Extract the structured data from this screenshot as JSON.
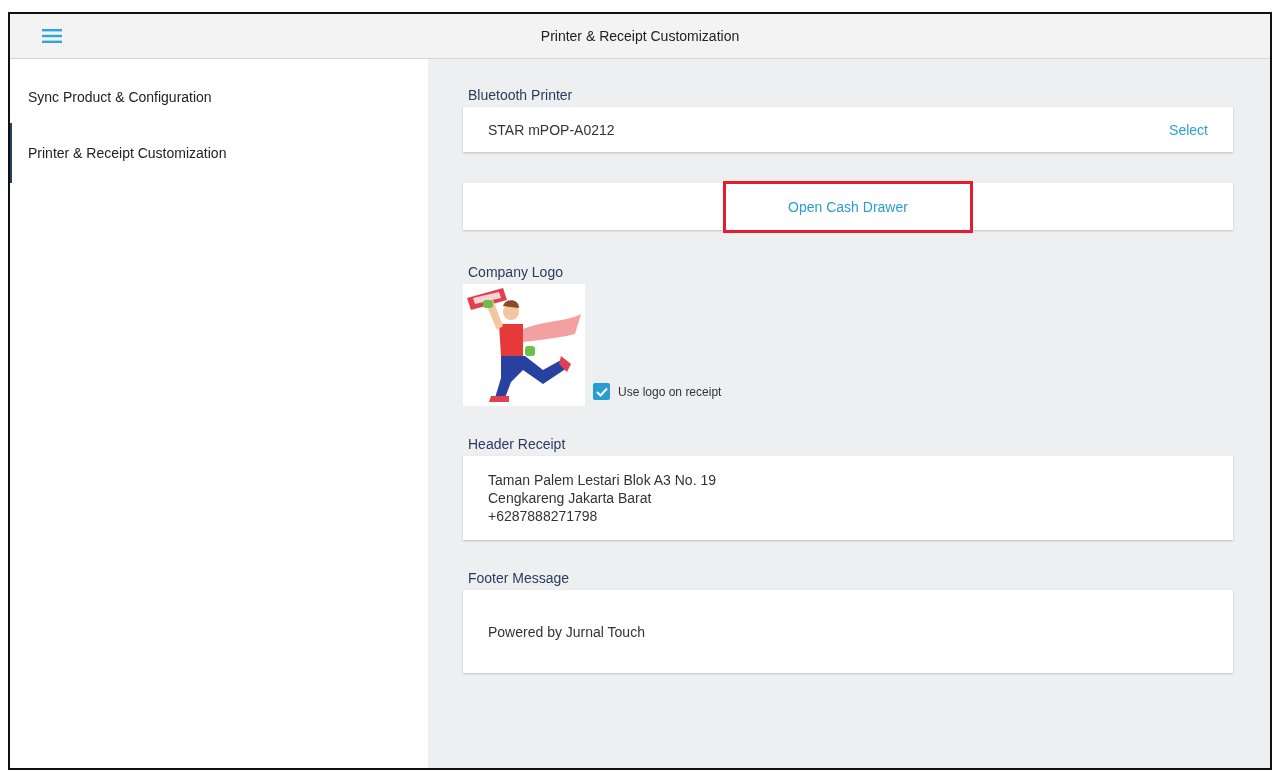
{
  "app_bar": {
    "title": "Printer & Receipt Customization"
  },
  "sidebar": {
    "items": [
      {
        "label": "Sync Product & Configuration",
        "selected": false
      },
      {
        "label": "Printer & Receipt Customization",
        "selected": true
      }
    ]
  },
  "bluetooth_printer": {
    "label": "Bluetooth Printer",
    "value": "STAR mPOP-A0212",
    "action": "Select"
  },
  "cash_drawer": {
    "label": "Open Cash Drawer",
    "highlighted": true
  },
  "company_logo": {
    "label": "Company Logo",
    "use_logo": {
      "label": "Use logo on receipt",
      "checked": true
    }
  },
  "header_receipt": {
    "label": "Header Receipt",
    "lines": [
      "Taman Palem Lestari Blok A3 No. 19",
      "Cengkareng Jakarta Barat",
      "+6287888271798"
    ]
  },
  "footer_message": {
    "label": "Footer Message",
    "value": "Powered by Jurnal Touch"
  }
}
